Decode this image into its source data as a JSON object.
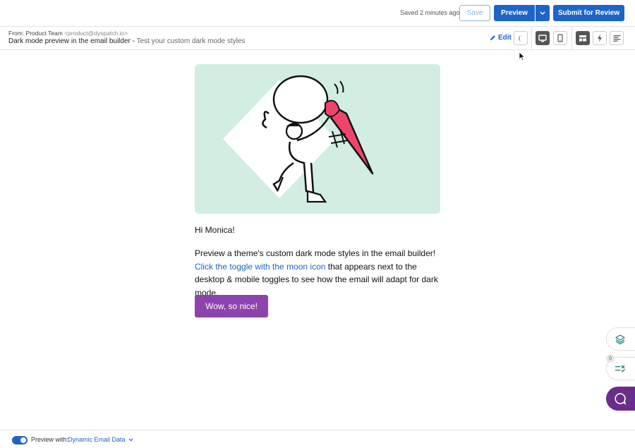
{
  "topbar": {
    "saved_status": "Saved 2 minutes ago",
    "save_label": "Save",
    "preview_label": "Preview",
    "submit_label": "Submit for Review"
  },
  "header": {
    "from_label": "From: Product Team",
    "from_address": "<product@dyspatch.io>",
    "subject": "Dark mode preview in the email builder",
    "separator": " - ",
    "preheader": "Test your custom dark mode styles",
    "edit_label": "Edit"
  },
  "email": {
    "greeting": "Hi Monica!",
    "paragraph_start": "Preview a theme's custom dark mode styles in the email builder! ",
    "paragraph_link": "Click the toggle with the moon icon",
    "paragraph_end": " that appears next to the desktop & mobile toggles to see how the email will adapt for dark mode.",
    "cta_label": "Wow, so nice!"
  },
  "side": {
    "badge_count": "0"
  },
  "footer": {
    "preview_with_label": "Preview with:",
    "data_source": "Dynamic Email Data"
  },
  "colors": {
    "primary": "#1e64c8",
    "cta": "#8e44ad",
    "hero_bg": "#d2ede2",
    "chat": "#6a2d8a"
  }
}
